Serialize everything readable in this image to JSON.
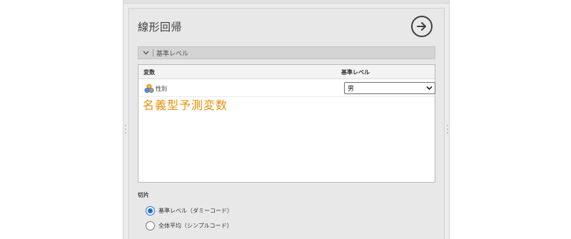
{
  "title": "線形回帰",
  "run_button_icon": "arrow-right-circle-icon",
  "section": {
    "label": "基準レベル",
    "toggle_icon": "chevron-down-icon"
  },
  "table": {
    "headers": {
      "variable": "変数",
      "reference_level": "基準レベル"
    },
    "rows": [
      {
        "variable": "性別",
        "icon": "nominal-variable-icon",
        "reference_level": "男"
      }
    ]
  },
  "annotation": "名義型予測変数",
  "intercept": {
    "label": "切片",
    "options": [
      {
        "label": "基準レベル（ダミーコード）",
        "selected": true
      },
      {
        "label": "全体平均（シンプルコード）",
        "selected": false
      }
    ]
  },
  "colors": {
    "annotation": "#e8920c",
    "radio_accent": "#1d6fd6"
  }
}
